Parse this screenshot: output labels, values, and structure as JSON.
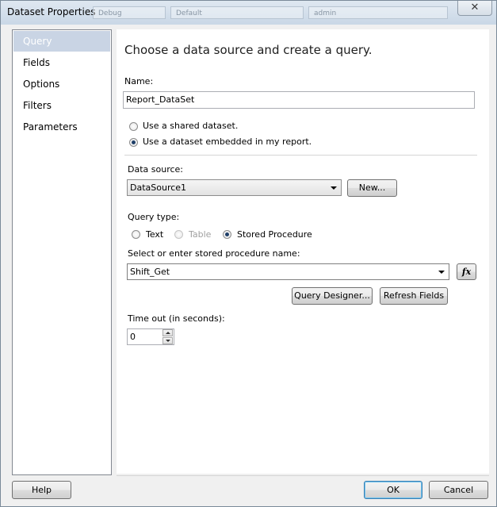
{
  "window": {
    "title": "Dataset Properties",
    "close_symbol": "✕",
    "background_toolbar": [
      "Debug",
      "Default",
      "admin"
    ]
  },
  "sidebar": {
    "items": [
      {
        "label": "Query",
        "selected": true
      },
      {
        "label": "Fields",
        "selected": false
      },
      {
        "label": "Options",
        "selected": false
      },
      {
        "label": "Filters",
        "selected": false
      },
      {
        "label": "Parameters",
        "selected": false
      }
    ]
  },
  "main": {
    "heading": "Choose a data source and create a query.",
    "name_label": "Name:",
    "name_value": "Report_DataSet",
    "dataset_options": {
      "shared": "Use a shared dataset.",
      "embedded": "Use a dataset embedded in my report.",
      "selected": "embedded"
    },
    "data_source_label": "Data source:",
    "data_source_value": "DataSource1",
    "new_button": "New...",
    "query_type_label": "Query type:",
    "query_types": {
      "text": "Text",
      "table": "Table",
      "stored_procedure": "Stored Procedure",
      "selected": "stored_procedure"
    },
    "sp_label": "Select or enter stored procedure name:",
    "sp_value": "Shift_Get",
    "fx_button": "fx",
    "query_designer_button": "Query Designer...",
    "refresh_fields_button": "Refresh Fields",
    "timeout_label": "Time out (in seconds):",
    "timeout_value": "0"
  },
  "footer": {
    "help_button": "Help",
    "ok_button": "OK",
    "cancel_button": "Cancel"
  }
}
